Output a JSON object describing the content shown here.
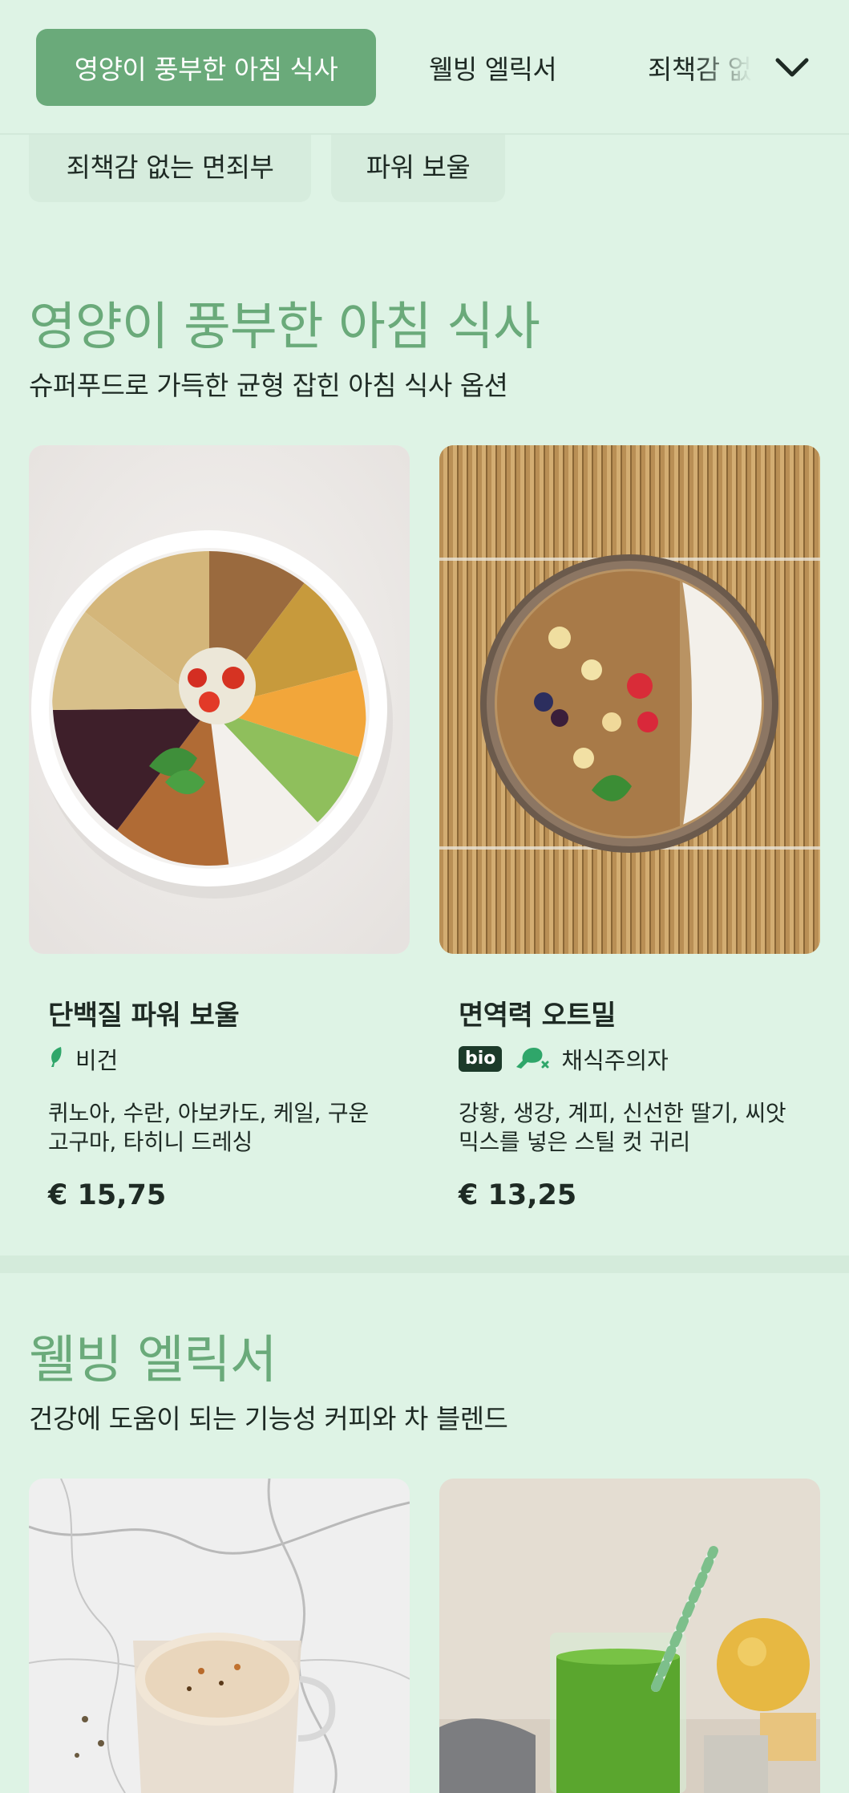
{
  "nav": {
    "active_tab": "영양이 풍부한 아침 식사",
    "tab_wellbeing": "웰빙 엘릭서",
    "tab_guilt": "죄책감 없",
    "expand_icon": "chevron-down-icon",
    "chips": [
      "죄책감 없는 면죄부",
      "파워 보울"
    ]
  },
  "colors": {
    "accent": "#6aaa7a",
    "background": "#def3e5",
    "badge": "#1c3a2a",
    "leaf": "#2fa66a"
  },
  "breakfast": {
    "title": "영양이 풍부한 아침 식사",
    "subtitle": "슈퍼푸드로 가득한 균형 잡힌 아침 식사 옵션",
    "items": [
      {
        "name": "단백질 파워 보울",
        "tag_icon": "leaf-icon",
        "tag": "비건",
        "desc": "퀴노아, 수란, 아보카도, 케일, 구운 고구마, 타히니 드레싱",
        "price": "€ 15,75"
      },
      {
        "name": "면역력 오트밀",
        "badge": "bio",
        "tag_icon": "chicken-leg-icon",
        "tag": "채식주의자",
        "desc": "강황, 생강, 계피, 신선한 딸기, 씨앗 믹스를 넣은 스틸 컷 귀리",
        "price": "€ 13,25"
      }
    ]
  },
  "elixirs": {
    "title": "웰빙 엘릭서",
    "subtitle": "건강에 도움이 되는 기능성 커피와 차 블렌드"
  }
}
